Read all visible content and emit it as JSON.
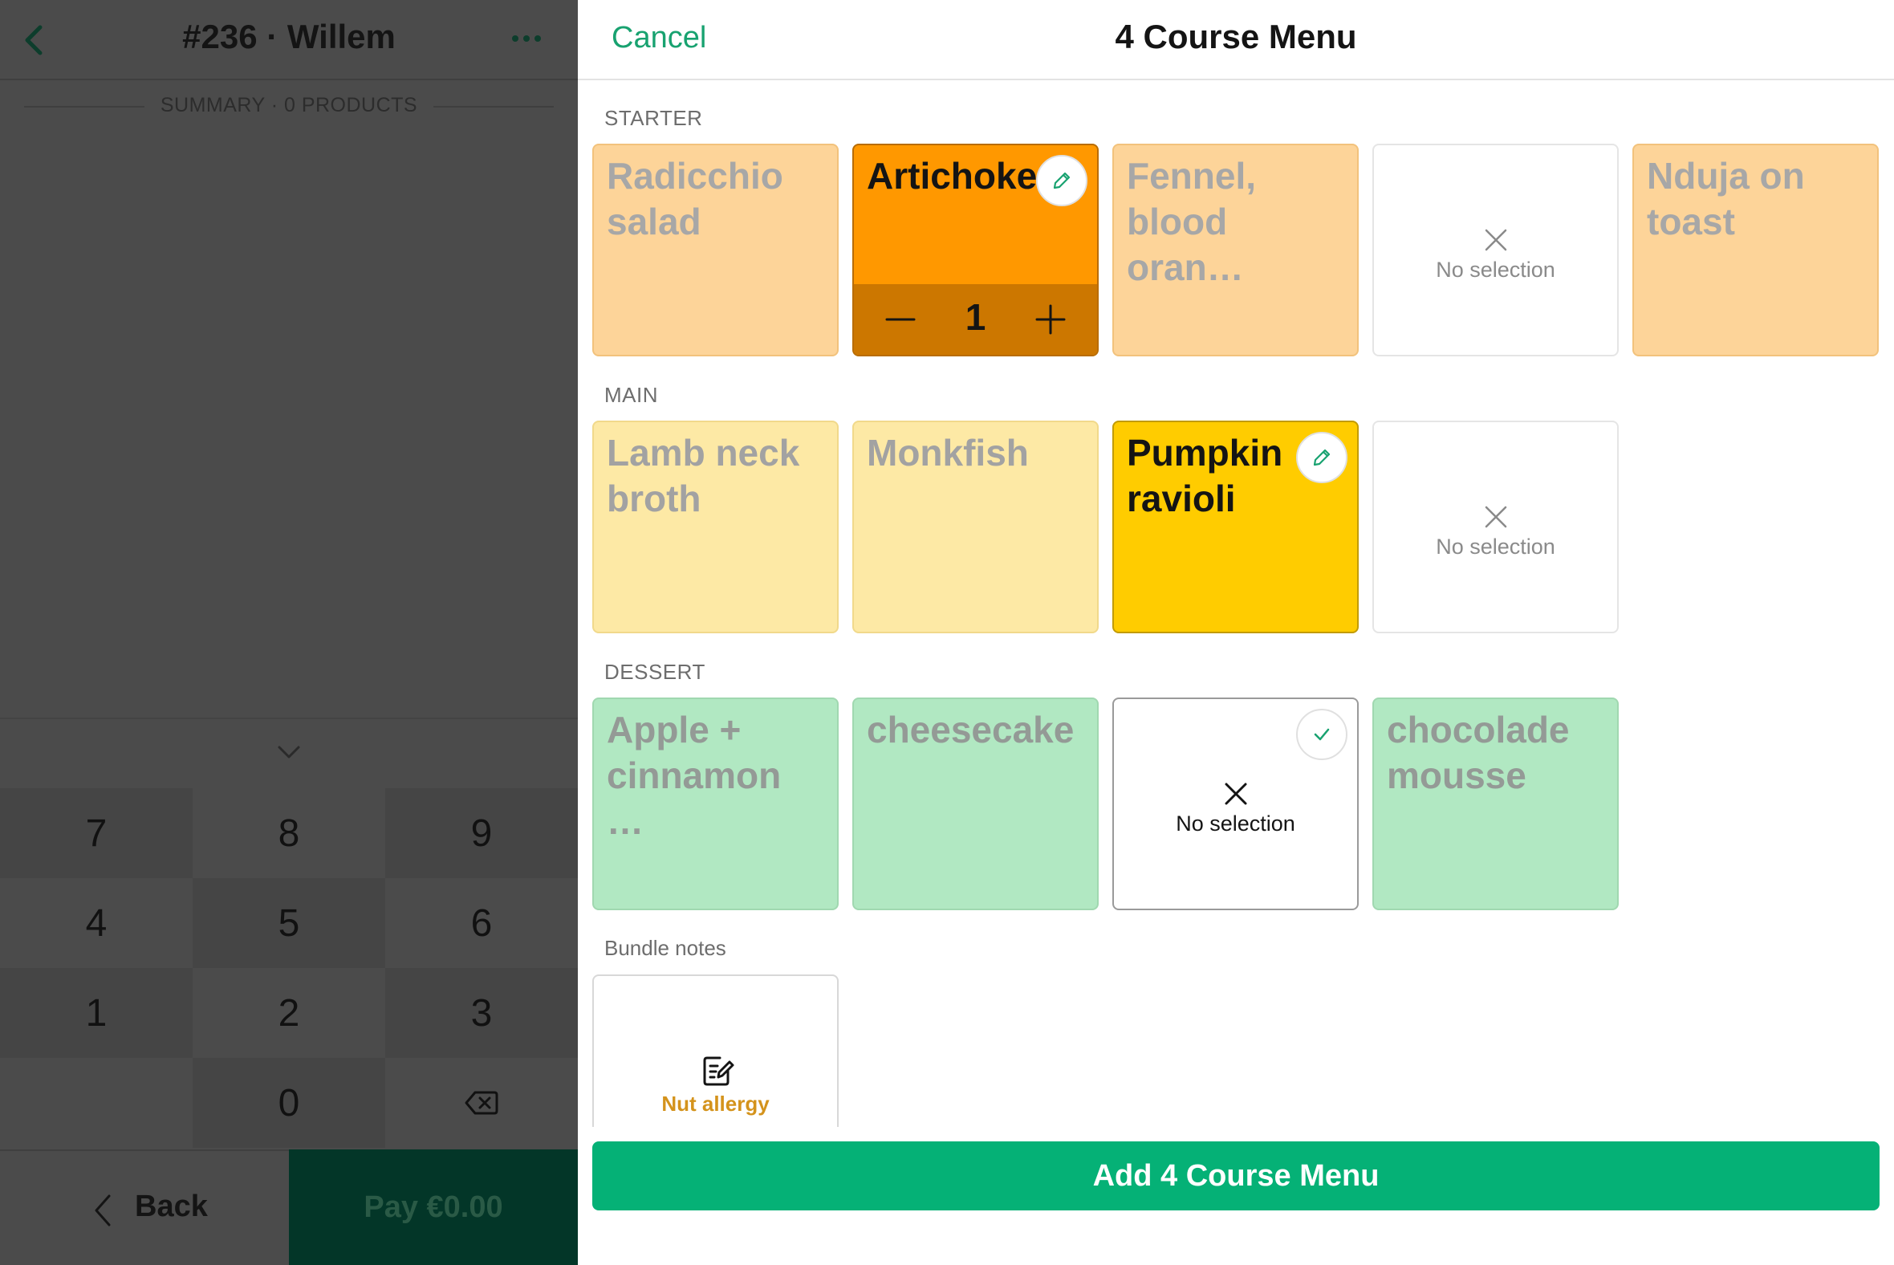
{
  "order_panel": {
    "title": "#236 · Willem",
    "summary": "SUMMARY · 0 PRODUCTS",
    "keypad": [
      "7",
      "8",
      "9",
      "4",
      "5",
      "6",
      "1",
      "2",
      "3",
      "",
      "0"
    ],
    "back_label": "Back",
    "pay_label": "Pay €0.00"
  },
  "modal": {
    "cancel_label": "Cancel",
    "title": "4 Course Menu",
    "sections": {
      "starter": {
        "label": "STARTER",
        "items": [
          {
            "name": "Radicchio salad"
          },
          {
            "name": "Artichokes",
            "quantity": "1",
            "selected": true
          },
          {
            "name": "Fennel, blood oran…"
          },
          {
            "name": "No selection"
          },
          {
            "name": "Nduja on toast"
          }
        ]
      },
      "main": {
        "label": "MAIN",
        "items": [
          {
            "name": "Lamb neck broth"
          },
          {
            "name": "Monkfish"
          },
          {
            "name": "Pumpkin ravioli",
            "selected": true
          },
          {
            "name": "No selection"
          }
        ]
      },
      "dessert": {
        "label": "DESSERT",
        "items": [
          {
            "name": "Apple + cinnamon …"
          },
          {
            "name": "cheesecake"
          },
          {
            "name": "No selection",
            "selected": true
          },
          {
            "name": "chocolade mousse"
          }
        ]
      },
      "notes": {
        "label": "Bundle notes",
        "note": "Nut allergy"
      }
    },
    "add_label": "Add 4 Course Menu"
  },
  "colors": {
    "accent_green": "#05b176",
    "starter_selected": "#ff9800",
    "main_selected": "#ffcc00",
    "dessert_light": "#b1e8c2",
    "note_text": "#d4931c"
  },
  "icons": [
    "chevron-left-icon",
    "more-icon",
    "chevron-down-icon",
    "backspace-icon",
    "pencil-icon",
    "minus-icon",
    "plus-icon",
    "close-icon",
    "check-icon",
    "note-edit-icon"
  ]
}
